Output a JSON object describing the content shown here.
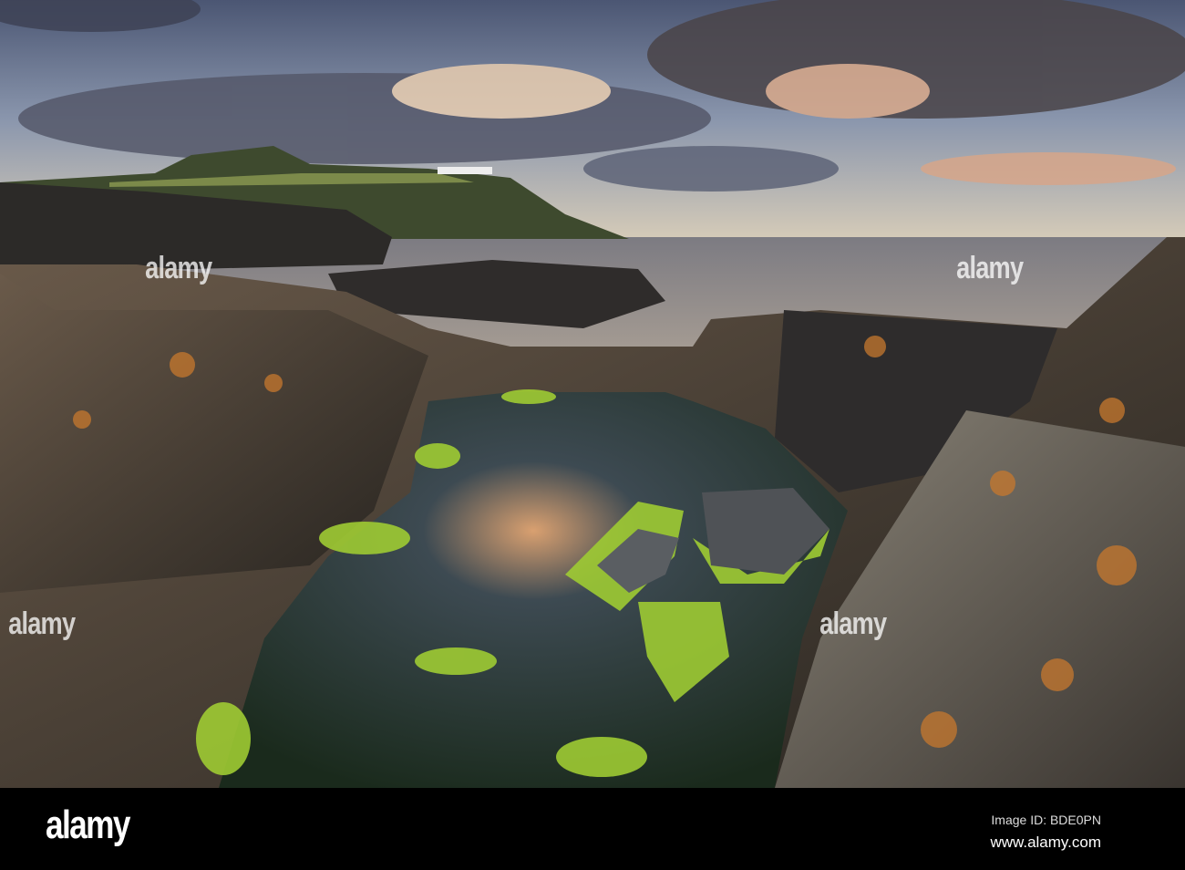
{
  "footer": {
    "logo": "alamy",
    "image_id": "Image ID: BDE0PN",
    "site": "www.alamy.com"
  },
  "watermark": "alamy",
  "colors": {
    "sky_top": "#4e5c78",
    "sky_horizon": "#c9c3b5",
    "sea": "#8b8582",
    "rock": "#3a3633",
    "lichen": "#c7782e",
    "weed": "#a6d23a"
  }
}
